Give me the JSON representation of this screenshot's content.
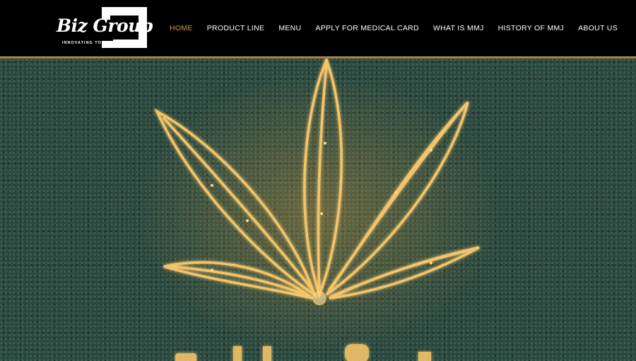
{
  "logo": {
    "title": "Biz Group",
    "tagline": "INNOVATING TOGETHER"
  },
  "nav": {
    "items": [
      {
        "label": "HOME",
        "active": true
      },
      {
        "label": "PRODUCT LINE"
      },
      {
        "label": "MENU"
      },
      {
        "label": "APPLY FOR MEDICAL CARD"
      },
      {
        "label": "WHAT IS MMJ"
      },
      {
        "label": "HISTORY OF MMJ"
      },
      {
        "label": "ABOUT US"
      }
    ]
  },
  "colors": {
    "header_bg": "#000000",
    "active_nav": "#d39b45",
    "gold_accent": "#c9a55a",
    "hero_bg": "#2c4940",
    "leaf_glow": "#f3c56a"
  },
  "hero": {
    "image": "glowing-cannabis-leaf-illustration"
  }
}
